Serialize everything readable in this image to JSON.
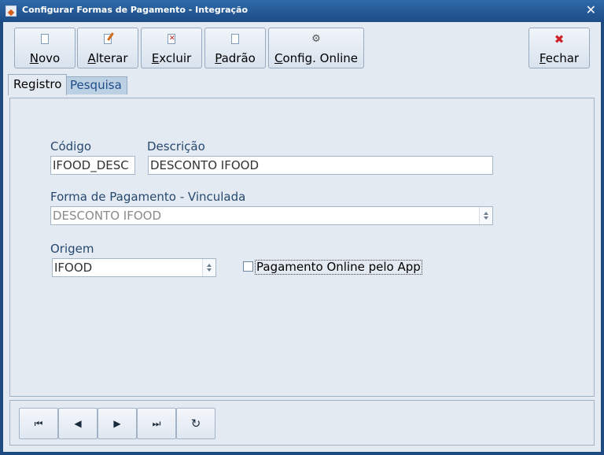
{
  "window": {
    "title": "Configurar Formas de Pagamento - Integração",
    "close_symbol": "✕"
  },
  "toolbar": {
    "novo": {
      "mnemonic": "N",
      "rest": "ovo",
      "icon": "new-document-icon"
    },
    "alterar": {
      "mnemonic": "A",
      "rest": "lterar",
      "icon": "edit-pencil-icon"
    },
    "excluir": {
      "mnemonic": "E",
      "rest": "xcluir",
      "icon": "delete-document-icon"
    },
    "padrao": {
      "mnemonic": "P",
      "rest": "adrão",
      "icon": "default-document-icon"
    },
    "config": {
      "mnemonic": "C",
      "rest": "onfig. Online",
      "icon": "gear-icon"
    },
    "fechar": {
      "mnemonic": "F",
      "rest": "echar",
      "icon": "close-red-x-icon",
      "icon_color": "#d0202a"
    }
  },
  "tabs": {
    "registro": "Registro",
    "pesquisa": "Pesquisa"
  },
  "form": {
    "codigo_label": "Código",
    "codigo_value": "IFOOD_DESC",
    "descricao_label": "Descrição",
    "descricao_value": "DESCONTO IFOOD",
    "forma_label": "Forma de Pagamento - Vinculada",
    "forma_value": "DESCONTO IFOOD",
    "origem_label": "Origem",
    "origem_value": "IFOOD",
    "pagamento_online_label": "Pagamento Online pelo App",
    "pagamento_online_checked": false
  },
  "navigation": {
    "first": "⏮",
    "prev": "◀",
    "next": "▶",
    "last": "⏭",
    "refresh": "↻"
  }
}
